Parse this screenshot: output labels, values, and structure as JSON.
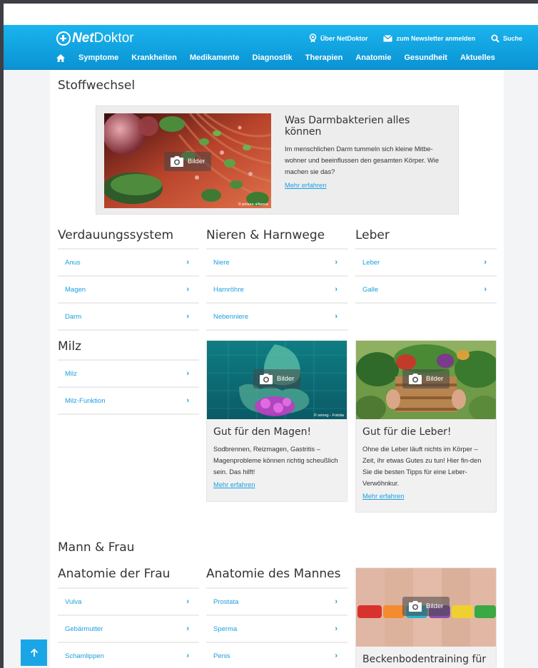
{
  "header": {
    "logo_net": "Net",
    "logo_doktor": "Doktor",
    "top_links": {
      "about": "Über NetDoktor",
      "newsletter": "zum Newsletter anmelden",
      "search": "Suche"
    },
    "nav": [
      "Symptome",
      "Krankheiten",
      "Medikamente",
      "Diagnostik",
      "Therapien",
      "Anatomie",
      "Gesundheit",
      "Aktuelles"
    ]
  },
  "section1": {
    "title": "Stoffwechsel",
    "teaser": {
      "title": "Was Darmbakterien alles können",
      "body": "Im menschlichen Darm tummeln sich kleine Mitbe-wohner und beeinflussen den gesamten Körper. Wie machen sie das?",
      "link": "Mehr erfahren",
      "bilder": "Bilder",
      "credit": "© picture alliance"
    },
    "groups": [
      {
        "title": "Verdauungssystem",
        "items": [
          "Anus",
          "Magen",
          "Darm"
        ]
      },
      {
        "title": "Nieren & Harnwege",
        "items": [
          "Niere",
          "Harnröhre",
          "Nebenniere"
        ]
      },
      {
        "title": "Leber",
        "items": [
          "Leber",
          "Galle"
        ]
      },
      {
        "title": "Milz",
        "items": [
          "Milz",
          "Milz-Funktion"
        ]
      }
    ],
    "cards": [
      {
        "title": "Gut für den Magen!",
        "body": "Sodbrennen, Reizmagen, Gastritis – Magenprobleme können richtig scheußlich sein. Das hilft!",
        "link": "Mehr erfahren",
        "bilder": "Bilder",
        "credit": "© reineg - Fotolia"
      },
      {
        "title": "Gut für die Leber!",
        "body": "Ohne die Leber läuft nichts im Körper – Zeit, ihr etwas Gutes zu tun! Hier fin-den Sie die besten Tipps für eine Leber-Verwöhnkur.",
        "link": "Mehr erfahren",
        "bilder": "Bilder"
      }
    ]
  },
  "section2": {
    "title": "Mann & Frau",
    "groups": [
      {
        "title": "Anatomie der Frau",
        "items": [
          "Vulva",
          "Gebärmutter",
          "Schamlippen"
        ]
      },
      {
        "title": "Anatomie des Mannes",
        "items": [
          "Prostata",
          "Sperma",
          "Penis"
        ]
      }
    ],
    "card": {
      "title": "Beckenbodentraining für",
      "bilder": "Bilder"
    }
  },
  "colors": {
    "brand": "#1aa6e6",
    "link": "#1b9fe0",
    "text": "#333333"
  }
}
